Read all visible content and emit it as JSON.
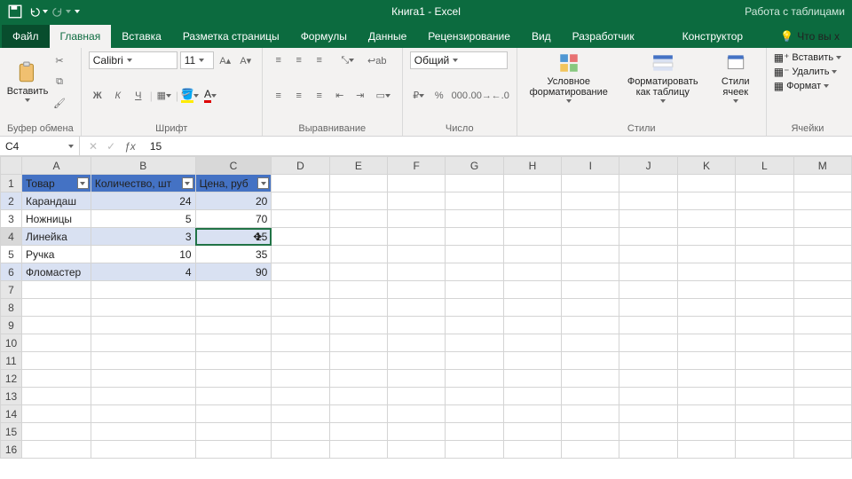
{
  "title": "Книга1  -  Excel",
  "context_tab": "Работа с таблицами",
  "tell_me": "Что вы х",
  "tabs": {
    "file": "Файл",
    "home": "Главная",
    "insert": "Вставка",
    "layout": "Разметка страницы",
    "formulas": "Формулы",
    "data_t": "Данные",
    "review": "Рецензирование",
    "view": "Вид",
    "dev": "Разработчик",
    "design": "Конструктор"
  },
  "ribbon": {
    "clipboard": {
      "paste": "Вставить",
      "label": "Буфер обмена"
    },
    "font": {
      "name": "Calibri",
      "size": "11",
      "label": "Шрифт",
      "b": "Ж",
      "i": "К",
      "u": "Ч"
    },
    "align": {
      "label": "Выравнивание"
    },
    "number": {
      "format": "Общий",
      "label": "Число"
    },
    "styles": {
      "cond": "Условное форматирование",
      "table": "Форматировать как таблицу",
      "cell": "Стили ячеек",
      "label": "Стили"
    },
    "cells": {
      "insert": "Вставить",
      "delete": "Удалить",
      "format": "Формат",
      "label": "Ячейки"
    }
  },
  "namebox": "C4",
  "formula": "15",
  "columns": [
    "A",
    "B",
    "C",
    "D",
    "E",
    "F",
    "G",
    "H",
    "I",
    "J",
    "K",
    "L",
    "M"
  ],
  "headers": [
    "Товар",
    "Количество, шт",
    "Цена, руб"
  ],
  "data": [
    {
      "a": "Карандаш",
      "b": "24",
      "c": "20"
    },
    {
      "a": "Ножницы",
      "b": "5",
      "c": "70"
    },
    {
      "a": "Линейка",
      "b": "3",
      "c": "15"
    },
    {
      "a": "Ручка",
      "b": "10",
      "c": "35"
    },
    {
      "a": "Фломастер",
      "b": "4",
      "c": "90"
    }
  ],
  "chart_data": {
    "type": "table",
    "columns": [
      "Товар",
      "Количество, шт",
      "Цена, руб"
    ],
    "rows": [
      [
        "Карандаш",
        24,
        20
      ],
      [
        "Ножницы",
        5,
        70
      ],
      [
        "Линейка",
        3,
        15
      ],
      [
        "Ручка",
        10,
        35
      ],
      [
        "Фломастер",
        4,
        90
      ]
    ]
  }
}
